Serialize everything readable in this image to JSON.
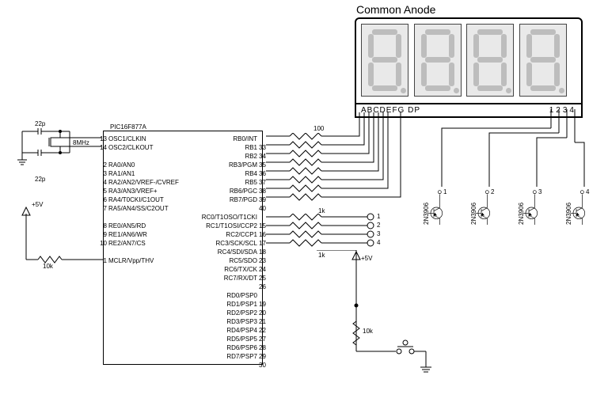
{
  "title": "Common Anode",
  "mcu": {
    "name": "PIC16F877A",
    "left_pins": [
      {
        "num": "13",
        "label": "OSC1/CLKIN"
      },
      {
        "num": "14",
        "label": "OSC2/CLKOUT"
      },
      {
        "num": "",
        "label": ""
      },
      {
        "num": "2",
        "label": "RA0/AN0"
      },
      {
        "num": "3",
        "label": "RA1/AN1"
      },
      {
        "num": "4",
        "label": "RA2/AN2/VREF-/CVREF"
      },
      {
        "num": "5",
        "label": "RA3/AN3/VREF+"
      },
      {
        "num": "6",
        "label": "RA4/T0CKI/C1OUT"
      },
      {
        "num": "7",
        "label": "RA5/AN4/SS/C2OUT"
      },
      {
        "num": "",
        "label": ""
      },
      {
        "num": "8",
        "label": "RE0/AN5/RD"
      },
      {
        "num": "9",
        "label": "RE1/AN6/WR"
      },
      {
        "num": "10",
        "label": "RE2/AN7/CS"
      },
      {
        "num": "",
        "label": ""
      },
      {
        "num": "1",
        "label": "MCLR/Vpp/THV"
      }
    ],
    "right_pins": [
      {
        "label": "RB0/INT",
        "num": "33"
      },
      {
        "label": "RB1",
        "num": "34"
      },
      {
        "label": "RB2",
        "num": "35"
      },
      {
        "label": "RB3/PGM",
        "num": "36"
      },
      {
        "label": "RB4",
        "num": "37"
      },
      {
        "label": "RB5",
        "num": "38"
      },
      {
        "label": "RB6/PGC",
        "num": "39"
      },
      {
        "label": "RB7/PGD",
        "num": "40"
      },
      {
        "label": "",
        "num": ""
      },
      {
        "label": "RC0/T1OSO/T1CKI",
        "num": "15"
      },
      {
        "label": "RC1/T1OSI/CCP2",
        "num": "16"
      },
      {
        "label": "RC2/CCP1",
        "num": "17"
      },
      {
        "label": "RC3/SCK/SCL",
        "num": "18"
      },
      {
        "label": "RC4/SDI/SDA",
        "num": "23"
      },
      {
        "label": "RC5/SDO",
        "num": "24"
      },
      {
        "label": "RC6/TX/CK",
        "num": "25"
      },
      {
        "label": "RC7/RX/DT",
        "num": "26"
      },
      {
        "label": "",
        "num": ""
      },
      {
        "label": "RD0/PSP0",
        "num": "19"
      },
      {
        "label": "RD1/PSP1",
        "num": "20"
      },
      {
        "label": "RD2/PSP2",
        "num": "21"
      },
      {
        "label": "RD3/PSP3",
        "num": "22"
      },
      {
        "label": "RD4/PSP4",
        "num": "27"
      },
      {
        "label": "RD5/PSP5",
        "num": "28"
      },
      {
        "label": "RD6/PSP6",
        "num": "29"
      },
      {
        "label": "RD7/PSP7",
        "num": "30"
      }
    ]
  },
  "display": {
    "seg_labels": "ABCDEFG  DP",
    "digit_labels": "1234"
  },
  "components": {
    "cap1": "22p",
    "cap2": "22p",
    "crystal": "8MHz",
    "vcc1": "+5V",
    "vcc2": "+5V",
    "r_mclr": "10k",
    "r_pullup": "10k",
    "r_seg": "100",
    "r_base": "1k",
    "r_base2": "1k"
  },
  "transistors": {
    "part": "2N3906",
    "labels": [
      "1",
      "2",
      "3",
      "4"
    ]
  },
  "net_labels": [
    "1",
    "2",
    "3",
    "4"
  ],
  "chart_data": {
    "type": "table",
    "title": "PIC16F877A 4-digit common-anode 7-segment driver schematic",
    "connections": [
      {
        "from": "OSC1/OSC2",
        "to": "8MHz crystal + 2×22p to GND"
      },
      {
        "from": "MCLR",
        "to": "+5V via 10k"
      },
      {
        "from": "RB0..RB6",
        "to": "segments A..G via 100Ω each"
      },
      {
        "from": "RB7",
        "to": "segment DP via 100Ω"
      },
      {
        "from": "RC0..RC3",
        "to": "bases of 4×2N3906 via 1k (nets 1..4)"
      },
      {
        "from": "2N3906 emitters (4)",
        "to": "+5V"
      },
      {
        "from": "2N3906 collectors",
        "to": "digit commons 1..4"
      },
      {
        "from": "RC4",
        "to": "pushbutton to GND, 10k pull-up to +5V"
      }
    ]
  }
}
